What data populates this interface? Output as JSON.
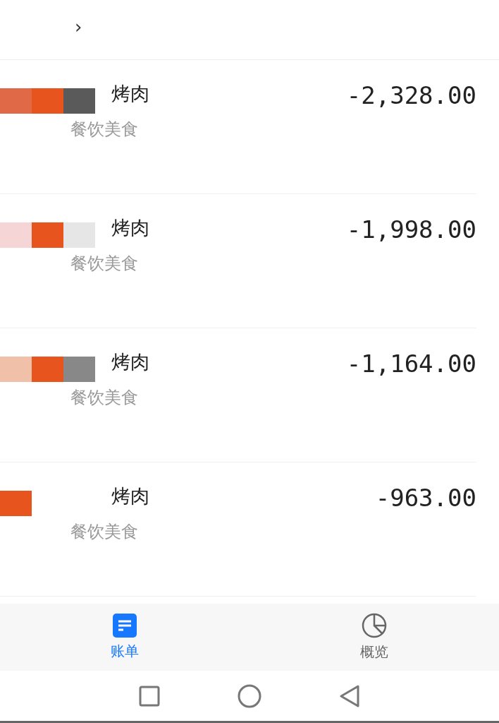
{
  "header": {
    "chevron": "›"
  },
  "bills": [
    {
      "title": "烤肉",
      "category": "餐饮美食",
      "amount": "-2,328.00"
    },
    {
      "title": "烤肉",
      "category": "餐饮美食",
      "amount": "-1,998.00"
    },
    {
      "title": "烤肉",
      "category": "餐饮美食",
      "amount": "-1,164.00"
    },
    {
      "title": "烤肉",
      "category": "餐饮美食",
      "amount": "-963.00"
    }
  ],
  "tabs": [
    {
      "kind": "bill",
      "label": "账单",
      "selected": true
    },
    {
      "kind": "overview",
      "label": "概览",
      "selected": false
    }
  ]
}
